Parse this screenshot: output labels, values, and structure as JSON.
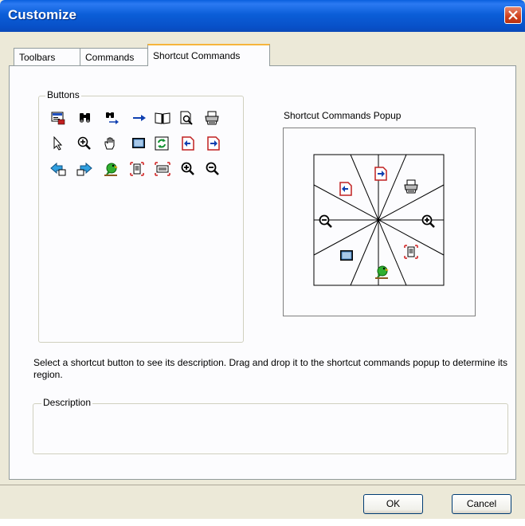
{
  "window": {
    "title": "Customize"
  },
  "tabs": [
    {
      "label": "Toolbars"
    },
    {
      "label": "Commands"
    },
    {
      "label": "Shortcut Commands"
    }
  ],
  "buttons_group": {
    "label": "Buttons",
    "rows": [
      [
        "template-icon",
        "binoculars-icon",
        "find-next-icon",
        "arrow-right-icon",
        "book-icon",
        "print-preview-icon",
        "printer-icon"
      ],
      [
        "pointer-icon",
        "zoom-region-icon",
        "hand-icon",
        "full-screen-icon",
        "refresh-page-icon",
        "previous-page-icon",
        "next-page-icon"
      ],
      [
        "back-icon",
        "forward-icon",
        "parrot-icon",
        "fit-page-icon",
        "fit-width-icon",
        "zoom-in-icon",
        "zoom-out-icon"
      ]
    ]
  },
  "popup": {
    "label": "Shortcut Commands Popup",
    "slots": [
      "next-page-icon",
      "printer-icon",
      "zoom-in-icon",
      "fit-page-icon",
      "parrot-icon",
      "full-screen-icon",
      "zoom-out-icon",
      "previous-page-icon"
    ]
  },
  "instructions": "Select a shortcut button to see its description. Drag and drop it to the shortcut commands popup to determine its region.",
  "description_group": {
    "label": "Description",
    "text": ""
  },
  "buttons": {
    "ok": "OK",
    "cancel": "Cancel"
  },
  "colors": {
    "titlebar": "#0a5fdd",
    "active_tab_highlight": "#f6b53c",
    "dialog_bg": "#ece9d8",
    "panel_bg": "#fcfcfe",
    "close_red": "#d0401c"
  }
}
